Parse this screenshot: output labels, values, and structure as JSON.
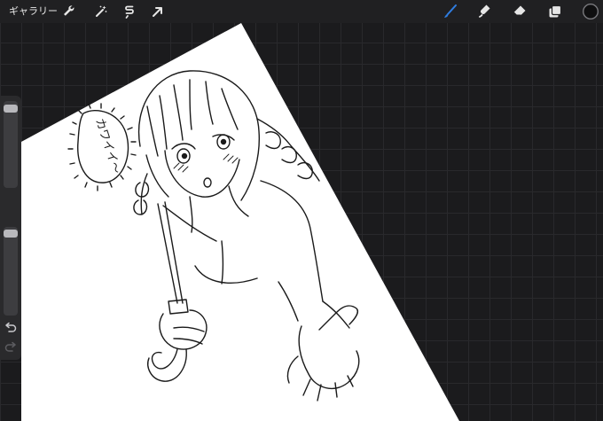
{
  "topbar": {
    "gallery_label": "ギャラリー",
    "left_tools": [
      "wrench-icon",
      "magic-wand-icon",
      "selection-icon",
      "transform-arrow-icon"
    ],
    "right_tools": [
      "brush-icon",
      "smudge-icon",
      "eraser-icon",
      "layers-icon",
      "color-swatch"
    ]
  },
  "canvas": {
    "speech_bubble_text": "カワイイ〜"
  },
  "sidebar": {
    "brush_size_level": 0.96,
    "opacity_level": 0.97
  },
  "colors": {
    "accent": "#2f7de1",
    "current_color": "#0f0f10",
    "background": "#1b1b1d"
  }
}
